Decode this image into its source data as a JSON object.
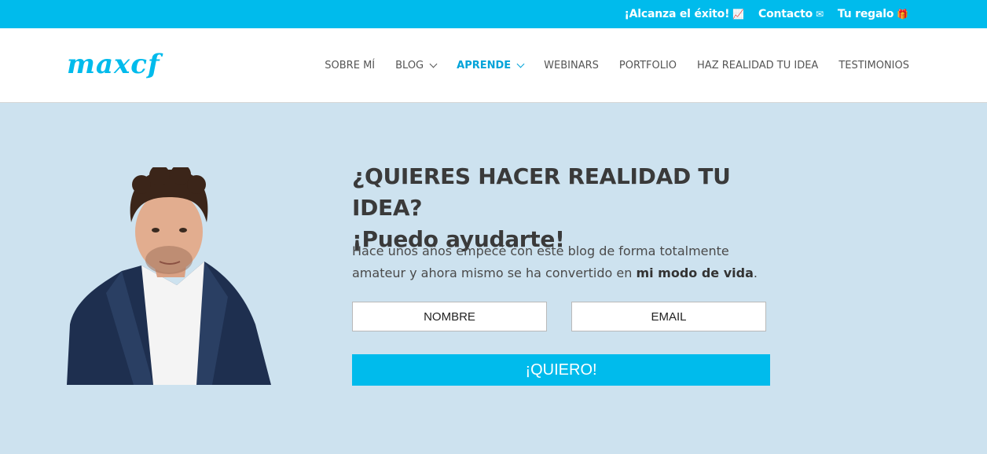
{
  "topbar": {
    "links": [
      {
        "label": "¡Alcanza el éxito!",
        "icon": "chart-icon"
      },
      {
        "label": "Contacto",
        "icon": "envelope-icon"
      },
      {
        "label": "Tu regalo",
        "icon": "gift-icon"
      }
    ],
    "bg_color": "#00bbec"
  },
  "header": {
    "logo": "maxcf",
    "nav": [
      "SOBRE MÍ",
      "BLOG",
      "APRENDE",
      "WEBINARS",
      "PORTFOLIO",
      "HAZ REALIDAD TU IDEA",
      "TESTIMONIOS"
    ],
    "active_item": "APRENDE"
  },
  "hero": {
    "title_line1": "¿QUIERES HACER REALIDAD TU IDEA?",
    "title_line2": "¡Puedo ayudarte!",
    "description_part1": "Hace unos años empecé con este blog de forma totalmente amateur y ahora mismo se ha convertido en ",
    "description_bold": "mi modo de vida",
    "description_end": ".",
    "name_placeholder": "NOMBRE",
    "email_placeholder": "EMAIL",
    "submit_label": "¡QUIERO!",
    "bg_color": "#cde2ef"
  }
}
